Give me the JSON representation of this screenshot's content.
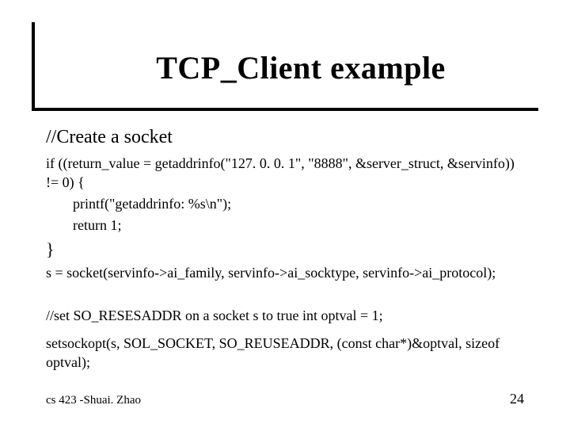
{
  "title": "TCP_Client example",
  "lines": {
    "heading1": "//Create a socket",
    "if_line": "if ((return_value = getaddrinfo(\"127. 0. 0. 1\", \"8888\", &server_struct, &servinfo)) != 0) {",
    "printf_line": "printf(\"getaddrinfo: %s\\n\");",
    "return_line": "return 1;",
    "close_brace": "}",
    "socket_line": "s = socket(servinfo->ai_family, servinfo->ai_socktype, servinfo->ai_protocol);",
    "comment2": "//set SO_RESESADDR on a socket s to true int optval = 1;",
    "setsockopt_line": "setsockopt(s, SOL_SOCKET, SO_REUSEADDR, (const char*)&optval, sizeof optval);"
  },
  "footer": {
    "left": "cs 423 -Shuai. Zhao",
    "right": "24"
  }
}
